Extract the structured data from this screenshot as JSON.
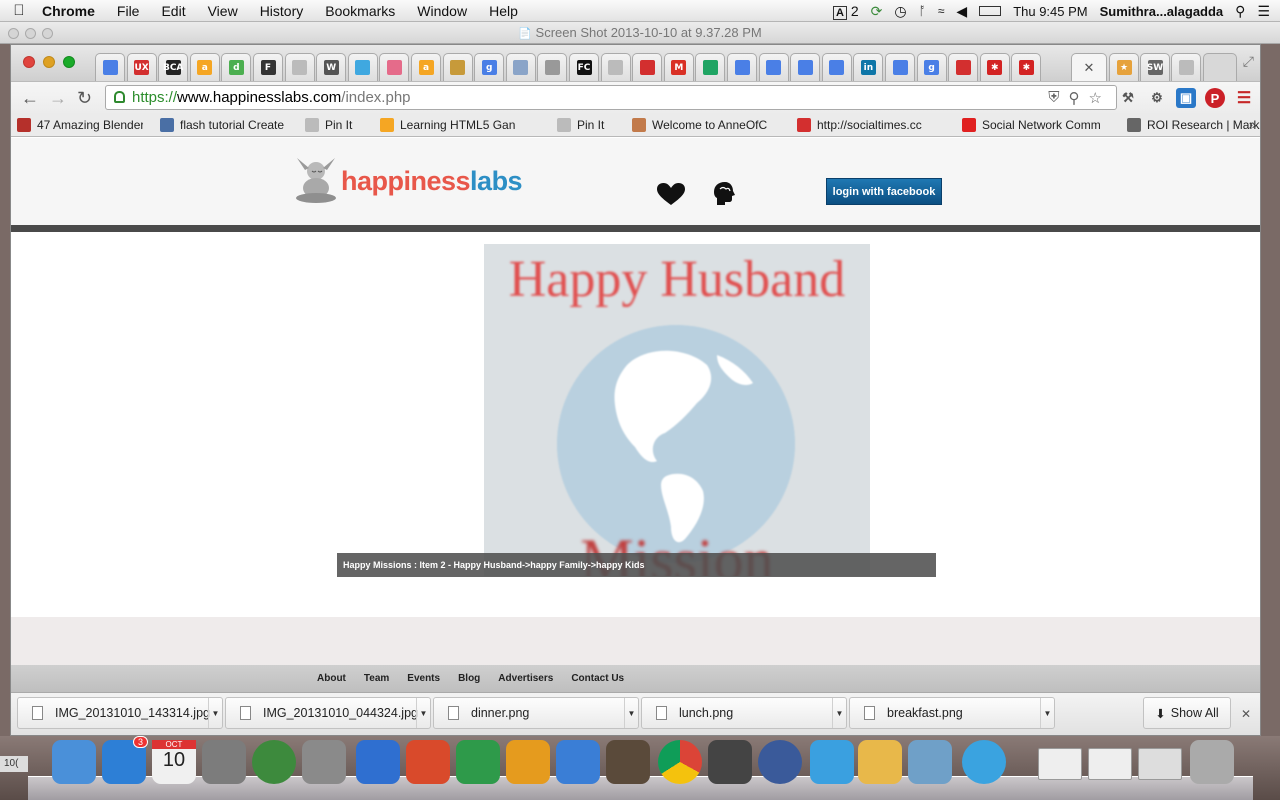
{
  "menubar": {
    "app": "Chrome",
    "items": [
      "File",
      "Edit",
      "View",
      "History",
      "Bookmarks",
      "Window",
      "Help"
    ],
    "status": {
      "adobe_count": "2",
      "clock": "Thu 9:45 PM",
      "user": "Sumithra...alagadda"
    }
  },
  "screenshot_window": {
    "title": "Screen Shot 2013-10-10 at 9.37.28 PM"
  },
  "tabs": [
    {
      "icon": "google-docs-icon",
      "text": "",
      "color": "#4a7fe6"
    },
    {
      "icon": "ux-icon",
      "text": "UX",
      "color": "#d32f2f"
    },
    {
      "icon": "bca-icon",
      "text": "BCA",
      "color": "#222222"
    },
    {
      "icon": "amazon-icon",
      "text": "a",
      "color": "#f5a623"
    },
    {
      "icon": "d-icon",
      "text": "d",
      "color": "#4caf50"
    },
    {
      "icon": "f-icon",
      "text": "F",
      "color": "#333333"
    },
    {
      "icon": "page-icon",
      "text": "",
      "color": "#bbbbbb"
    },
    {
      "icon": "wikipedia-icon",
      "text": "W",
      "color": "#555555"
    },
    {
      "icon": "globe-tab-icon",
      "text": "",
      "color": "#3fa8e0"
    },
    {
      "icon": "flower-icon",
      "text": "",
      "color": "#e56b8a"
    },
    {
      "icon": "amazon-icon",
      "text": "a",
      "color": "#f5a623"
    },
    {
      "icon": "pencil-icon",
      "text": "",
      "color": "#c79a3a"
    },
    {
      "icon": "google-icon",
      "text": "g",
      "color": "#4a7fe6"
    },
    {
      "icon": "image-icon",
      "text": "",
      "color": "#8aa4c8"
    },
    {
      "icon": "arc-icon",
      "text": "",
      "color": "#999999"
    },
    {
      "icon": "fc-icon",
      "text": "FC",
      "color": "#111111"
    },
    {
      "icon": "page-icon",
      "text": "",
      "color": "#bbbbbb"
    },
    {
      "icon": "red-bar-icon",
      "text": "",
      "color": "#d32f2f"
    },
    {
      "icon": "gmail-icon",
      "text": "M",
      "color": "#d93025"
    },
    {
      "icon": "drive-icon",
      "text": "",
      "color": "#1fa463"
    },
    {
      "icon": "google-docs-icon",
      "text": "",
      "color": "#4a7fe6"
    },
    {
      "icon": "google-docs-icon",
      "text": "",
      "color": "#4a7fe6"
    },
    {
      "icon": "google-docs-icon",
      "text": "",
      "color": "#4a7fe6"
    },
    {
      "icon": "google-docs-icon",
      "text": "",
      "color": "#4a7fe6"
    },
    {
      "icon": "linkedin-icon",
      "text": "in",
      "color": "#0e76a8"
    },
    {
      "icon": "google-docs-icon",
      "text": "",
      "color": "#4a7fe6"
    },
    {
      "icon": "google-icon",
      "text": "g",
      "color": "#4a7fe6"
    },
    {
      "icon": "chair-icon",
      "text": "",
      "color": "#d32f2f"
    },
    {
      "icon": "yelp-icon",
      "text": "✱",
      "color": "#d32323"
    },
    {
      "icon": "yelp-icon",
      "text": "✱",
      "color": "#d32323"
    }
  ],
  "tabs_right": [
    {
      "icon": "star-tab-icon",
      "text": "★",
      "color": "#e6a23c"
    },
    {
      "icon": "sw-icon",
      "text": "SW",
      "color": "#666666"
    },
    {
      "icon": "page-icon",
      "text": "",
      "color": "#bbbbbb"
    }
  ],
  "address": {
    "scheme": "https://",
    "host": "www.happinesslabs.com",
    "path": "/index.php"
  },
  "bookmarks": [
    {
      "label": "47 Amazing Blender",
      "icon": "red-cross-icon",
      "color": "#b5302b"
    },
    {
      "label": "flash tutorial Create",
      "icon": "y-icon",
      "color": "#4a6fa5"
    },
    {
      "label": "Pin It",
      "icon": "page-icon",
      "color": "#bbbbbb"
    },
    {
      "label": "Learning HTML5 Gan",
      "icon": "arrow-icon",
      "color": "#f5a623"
    },
    {
      "label": "Pin It",
      "icon": "page-icon",
      "color": "#bbbbbb"
    },
    {
      "label": "Welcome to AnneOfC",
      "icon": "avatar-icon",
      "color": "#c27a4a"
    },
    {
      "label": "http://socialtimes.cc",
      "icon": "st-icon",
      "color": "#d32f2f"
    },
    {
      "label": "Social Network Comm",
      "icon": "red-circle-icon",
      "color": "#e02020"
    },
    {
      "label": "ROI Research | Mark",
      "icon": "ring-icon",
      "color": "#666666"
    }
  ],
  "site": {
    "logo_word1": "happiness",
    "logo_word2": "labs",
    "login_label": "login with facebook",
    "brand_colors": {
      "red": "#e8574a",
      "blue": "#2d8fc5"
    }
  },
  "hero": {
    "title": "Happy Husband",
    "bottom_word": "Mission",
    "caption": "Happy Missions : Item 2 - Happy Husband->happy Family->happy Kids"
  },
  "footer_links": [
    "About",
    "Team",
    "Events",
    "Blog",
    "Advertisers",
    "Contact Us"
  ],
  "downloads": [
    {
      "name": "IMG_20131010_143314.jpg"
    },
    {
      "name": "IMG_20131010_044324.jpg"
    },
    {
      "name": "dinner.png"
    },
    {
      "name": "lunch.png"
    },
    {
      "name": "breakfast.png"
    }
  ],
  "downloads_show_all": "Show All",
  "dock": {
    "calendar_month": "OCT",
    "calendar_day": "10",
    "appstore_badge": "3",
    "desktop_label": "10(",
    "apps": [
      "finder-icon",
      "app-store-icon",
      "calendar-icon",
      "system-preferences-icon",
      "download-globe-icon",
      "satellite-icon",
      "word-icon",
      "powerpoint-icon",
      "excel-icon",
      "outlook-icon",
      "messenger-icon",
      "hawk-icon",
      "chrome-icon",
      "dashboard-icon",
      "time-machine-icon",
      "keynote-cloud-icon",
      "paint-icon",
      "preview-icon",
      "itunes-icon",
      "doc-thumb-icon",
      "doc-thumb-icon",
      "window-thumb-icon",
      "trash-icon"
    ],
    "colors": [
      "#4a90d9",
      "#2d7fd6",
      "#f0f0f0",
      "#7c7c7c",
      "#3d8a3d",
      "#8a8a8a",
      "#2f6fd0",
      "#d94a2b",
      "#2e9a4a",
      "#e59b1e",
      "#3a7ed6",
      "#5a4a3a",
      "#e9e9e9",
      "#444444",
      "#3a5a9a",
      "#3aa0e0",
      "#e8b84a",
      "#6fa0c8",
      "#3aa3e0",
      "#eeeeee",
      "#eeeeee",
      "#dddddd",
      "#aaaaaa"
    ]
  }
}
